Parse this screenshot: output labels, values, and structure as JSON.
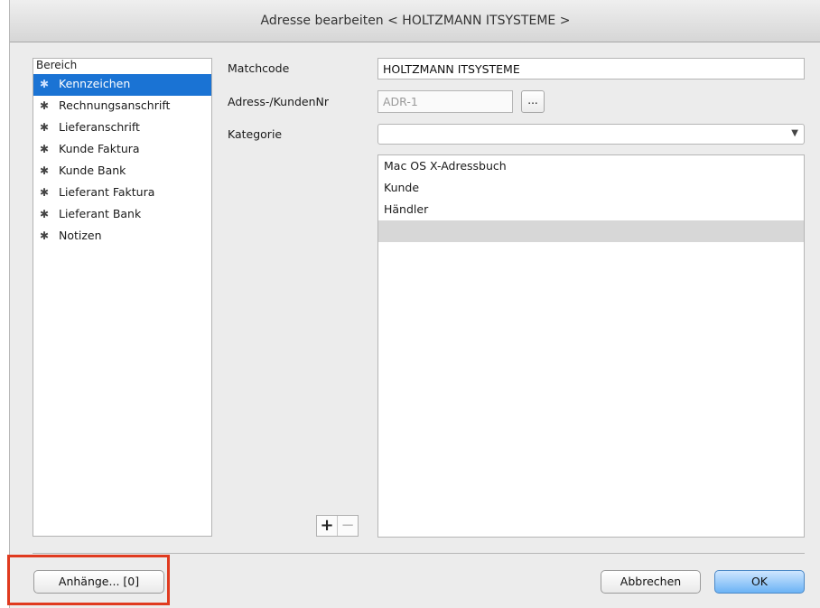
{
  "window": {
    "title": "Adresse bearbeiten < HOLTZMANN ITSYSTEME >"
  },
  "sidebar": {
    "header": "Bereich",
    "items": [
      {
        "label": "Kennzeichen",
        "selected": true,
        "icon": "gear-icon"
      },
      {
        "label": "Rechnungsanschrift",
        "icon": "gear-icon"
      },
      {
        "label": "Lieferanschrift",
        "icon": "gear-icon"
      },
      {
        "label": "Kunde Faktura",
        "icon": "gear-icon"
      },
      {
        "label": "Kunde Bank",
        "icon": "gear-icon"
      },
      {
        "label": "Lieferant Faktura",
        "icon": "gear-icon"
      },
      {
        "label": "Lieferant Bank",
        "icon": "gear-icon"
      },
      {
        "label": "Notizen",
        "icon": "gear-icon"
      }
    ]
  },
  "form": {
    "matchcode_label": "Matchcode",
    "matchcode_value": "HOLTZMANN ITSYSTEME",
    "adressnr_label": "Adress-/KundenNr",
    "adressnr_value": "ADR-1",
    "dots_label": "...",
    "kategorie_label": "Kategorie",
    "kategorie_value": ""
  },
  "categories": {
    "items": [
      "Mac OS X-Adressbuch",
      "Kunde",
      "Händler",
      ""
    ]
  },
  "controls": {
    "plus": "+",
    "minus": "−"
  },
  "footer": {
    "attachments_label": "Anhänge... [0]",
    "cancel_label": "Abbrechen",
    "ok_label": "OK"
  },
  "colors": {
    "selection": "#1a73d4",
    "ok_button": "#6cb3f5",
    "annotation": "#e03a1f"
  }
}
